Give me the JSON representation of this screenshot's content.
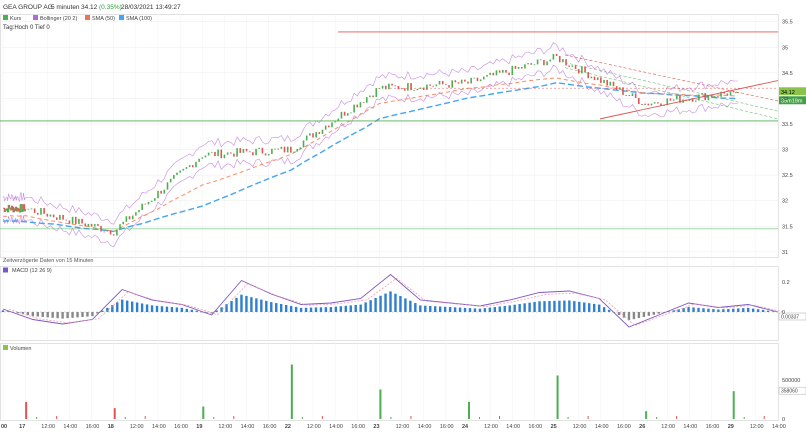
{
  "header": {
    "name": "GEA GROUP AG",
    "interval": "5 minuten",
    "price": "34.12",
    "change": "(0.35%)",
    "datetime": "28/03/2021 13:49:27",
    "subline": "Tag:Hoch 0 Tief 0",
    "delay_note": "Zeitverzögerte Daten von 15 Minuten"
  },
  "legend": [
    {
      "label": "Kurs",
      "color": "#4caf50",
      "icon": "square-kurs-icon"
    },
    {
      "label": "Bollinger (20 2)",
      "color": "#b06cd6",
      "icon": "square-bollinger-icon"
    },
    {
      "label": "SMA (50)",
      "color": "#e8775a",
      "icon": "square-sma50-icon"
    },
    {
      "label": "SMA (100)",
      "color": "#42a5f5",
      "icon": "square-sma100-icon"
    }
  ],
  "colors": {
    "up": "#4caf50",
    "down": "#e05656",
    "bollinger": "#c78be0",
    "sma50": "#ff8a65",
    "sma100": "#42a5f5",
    "macd": "#7e57c2",
    "signal": "#f48fb1",
    "hist_pos": "#2e7fd0",
    "hist_neg": "#888888",
    "support": "#4caf50",
    "resistance": "#e05656"
  },
  "price_panel": {
    "y_ticks": [
      "35.5",
      "35",
      "34.5",
      "34",
      "33.5",
      "33",
      "32.5",
      "32",
      "31.5",
      "31"
    ],
    "last_price_label": "34.12",
    "sub_label": "39m19m",
    "ylim": [
      30.9,
      35.65
    ]
  },
  "macd_panel": {
    "label": "MACD (12 26 9)",
    "y_ticks": [
      "0.2",
      "0"
    ],
    "last_label": "0.00337"
  },
  "volume_panel": {
    "label": "Volumen",
    "y_ticks": [
      "500000",
      "0"
    ],
    "last_label": "358060"
  },
  "x_axis": {
    "labels": [
      "00",
      "17",
      "12:00",
      "14:00",
      "16:00",
      "18",
      "12:00",
      "14:00",
      "16:00",
      "19",
      "12:00",
      "14:00",
      "16:00",
      "22",
      "12:00",
      "14:00",
      "16:00",
      "23",
      "12:00",
      "14:00",
      "16:00",
      "24",
      "12:00",
      "14:00",
      "16:00",
      "25",
      "12:00",
      "14:00",
      "16:00",
      "26",
      "12:00",
      "14:00",
      "16:00",
      "29",
      "12:00",
      "14:00"
    ]
  },
  "chart_data": [
    {
      "type": "line",
      "x": [
        "17",
        "18",
        "19",
        "22",
        "23",
        "24",
        "25",
        "26",
        "29"
      ],
      "series": [
        {
          "name": "Kurs",
          "values": [
            31.85,
            31.4,
            32.9,
            33.0,
            34.2,
            34.3,
            34.8,
            33.9,
            34.12
          ]
        },
        {
          "name": "SMA (50)",
          "values": [
            31.7,
            31.4,
            32.3,
            32.9,
            33.9,
            34.2,
            34.4,
            34.1,
            34.05
          ]
        },
        {
          "name": "SMA (100)",
          "values": [
            31.6,
            31.4,
            31.9,
            32.6,
            33.6,
            34.0,
            34.3,
            34.1,
            34.0
          ]
        }
      ],
      "ylim": [
        30.9,
        35.65
      ]
    },
    {
      "type": "line",
      "series": [
        {
          "name": "MACD (12 26 9)",
          "values": [
            0.02,
            -0.05,
            -0.08,
            -0.05,
            0.15,
            0.08,
            0.05,
            -0.02,
            0.21,
            0.12,
            0.05,
            0.06,
            0.09,
            0.25,
            0.08,
            0.06,
            0.04,
            0.08,
            0.13,
            0.14,
            0.09,
            -0.1,
            -0.02,
            0.06,
            0.03,
            0.05,
            0.0
          ]
        }
      ]
    },
    {
      "type": "bar",
      "series": [
        {
          "name": "Volumen",
          "values": [
            {
              "x": "17",
              "v": 220000
            },
            {
              "x": "18",
              "v": 140000
            },
            {
              "x": "19",
              "v": 160000
            },
            {
              "x": "22",
              "v": 700000
            },
            {
              "x": "23",
              "v": 380000
            },
            {
              "x": "24",
              "v": 220000
            },
            {
              "x": "25",
              "v": 560000
            },
            {
              "x": "26",
              "v": 100000
            },
            {
              "x": "29",
              "v": 358060
            }
          ]
        }
      ]
    }
  ]
}
